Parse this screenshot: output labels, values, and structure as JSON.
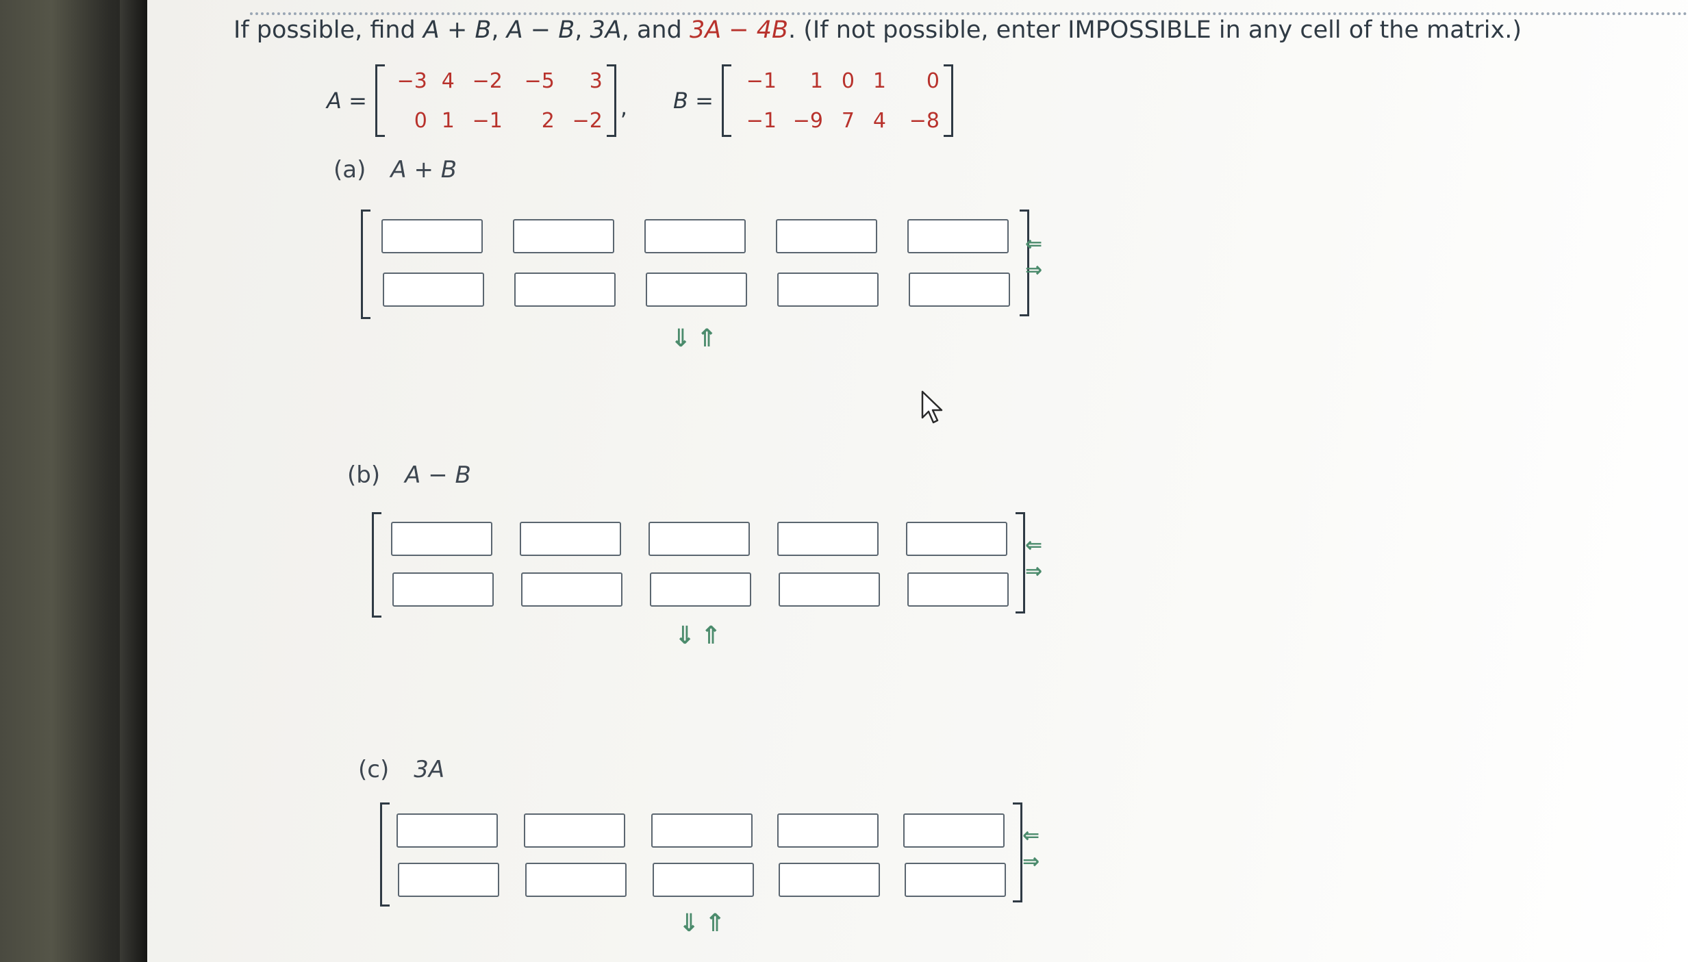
{
  "question": {
    "prefix": "If possible, find ",
    "t1": "A + B",
    "s1": ", ",
    "t2": "A − B",
    "s2": ", ",
    "t3": "3A",
    "s3": ", and ",
    "t4": "3A − 4B",
    "suffix": ". (If not possible, enter IMPOSSIBLE in any cell of the matrix.)"
  },
  "matrix_a": {
    "label": "A =",
    "rows": [
      [
        "−3",
        "4",
        "−2",
        "−5",
        "3"
      ],
      [
        "0",
        "1",
        "−1",
        "2",
        "−2"
      ]
    ]
  },
  "matrix_b": {
    "label": "B =",
    "rows": [
      [
        "−1",
        "1",
        "0",
        "1",
        "0"
      ],
      [
        "−1",
        "−9",
        "7",
        "4",
        "−8"
      ]
    ]
  },
  "parts": [
    {
      "label": "(a)",
      "expr": "A + B",
      "cells": [
        [
          "",
          "",
          "",
          "",
          ""
        ],
        [
          "",
          "",
          "",
          "",
          ""
        ]
      ]
    },
    {
      "label": "(b)",
      "expr": "A − B",
      "cells": [
        [
          "",
          "",
          "",
          "",
          ""
        ],
        [
          "",
          "",
          "",
          "",
          ""
        ]
      ]
    },
    {
      "label": "(c)",
      "expr": "3A",
      "cells": [
        [
          "",
          "",
          "",
          "",
          ""
        ],
        [
          "",
          "",
          "",
          "",
          ""
        ]
      ]
    }
  ],
  "controls": {
    "col_arrows": "⇐ ⇒",
    "row_arrows": "⇓⇑",
    "col_remove": "⇐",
    "col_add": "⇒",
    "row_add": "⇓",
    "row_remove": "⇑"
  },
  "colors": {
    "value_red": "#b8322c",
    "arrow_green": "#4b8b6c",
    "text": "#2f3a44"
  }
}
